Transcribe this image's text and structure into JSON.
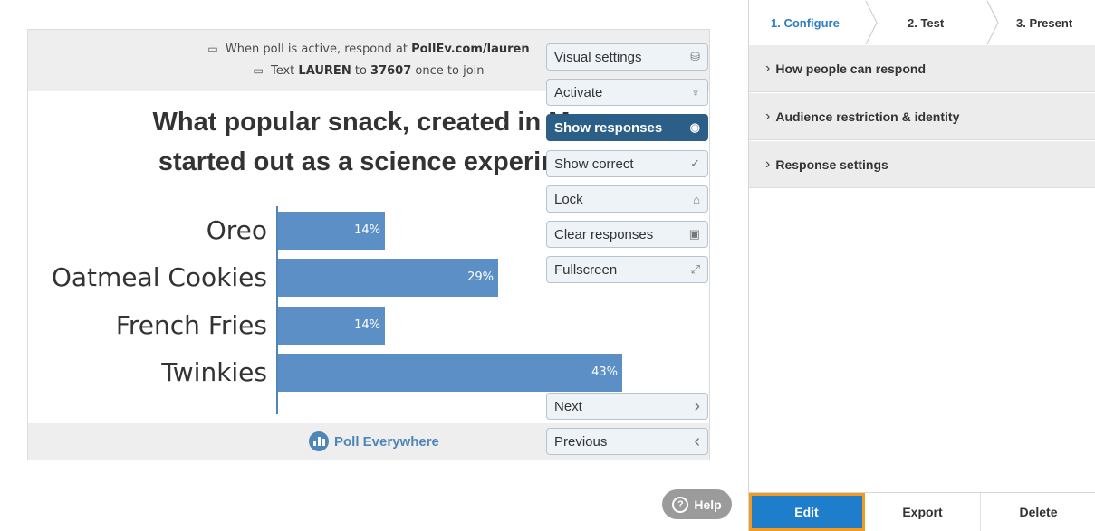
{
  "join": {
    "line1_prefix": "When poll is active, respond at",
    "line1_url": "PollEv.com/lauren",
    "line2_prefix": "Text",
    "line2_code": "LAUREN",
    "line2_mid": "to",
    "line2_number": "37607",
    "line2_suffix": "once to join"
  },
  "question": {
    "line1": "What popular snack, created in Ma",
    "line2": "started out as a science experime"
  },
  "chart_data": {
    "type": "bar",
    "orientation": "horizontal",
    "categories": [
      "Oreo",
      "Oatmeal Cookies",
      "French Fries",
      "Twinkies"
    ],
    "values": [
      14,
      29,
      14,
      43
    ],
    "value_labels": [
      "14%",
      "29%",
      "14%",
      "43%"
    ],
    "bar_color": "#5b8fc5"
  },
  "footer": {
    "brand": "Poll Everywhere"
  },
  "controls": [
    {
      "label": "Visual settings",
      "icon": "paint-bucket-icon",
      "glyph": "⛁",
      "active": false
    },
    {
      "label": "Activate",
      "icon": "broadcast-icon",
      "glyph": "♆",
      "active": false
    },
    {
      "label": "Show responses",
      "icon": "eye-icon",
      "glyph": "◉",
      "active": true
    },
    {
      "label": "Show correct",
      "icon": "check-icon",
      "glyph": "✓",
      "active": false
    },
    {
      "label": "Lock",
      "icon": "lock-icon",
      "glyph": "⌂",
      "active": false
    },
    {
      "label": "Clear responses",
      "icon": "trash-icon",
      "glyph": "▣",
      "active": false
    },
    {
      "label": "Fullscreen",
      "icon": "fullscreen-icon",
      "glyph": "⤢",
      "active": false
    }
  ],
  "nav_controls": [
    {
      "label": "Next",
      "glyph": "›"
    },
    {
      "label": "Previous",
      "glyph": "‹"
    }
  ],
  "steps": [
    "1. Configure",
    "2. Test",
    "3. Present"
  ],
  "accordion": [
    "How people can respond",
    "Audience restriction & identity",
    "Response settings"
  ],
  "bottom_actions": [
    "Edit",
    "Export",
    "Delete"
  ],
  "help": {
    "label": "Help"
  },
  "colors": {
    "accent": "#1f7ecb",
    "highlight": "#f39a1f",
    "active_control": "#2c5f88"
  }
}
